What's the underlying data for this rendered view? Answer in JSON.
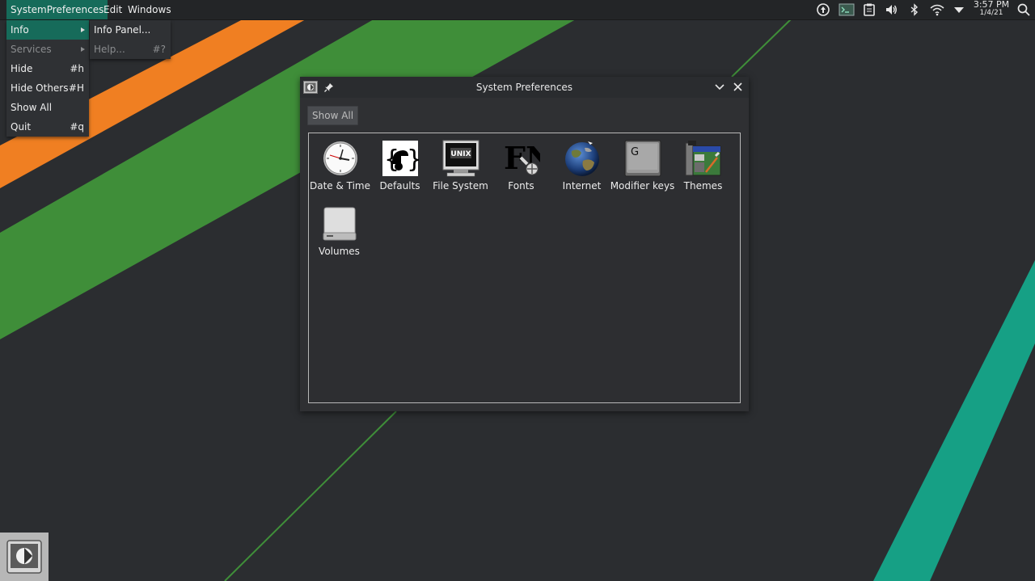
{
  "menubar": {
    "app_menu": "SystemPreferences",
    "edit": "Edit",
    "windows": "Windows"
  },
  "clock": {
    "time": "3:57 PM",
    "date": "1/4/21"
  },
  "tray_icons": [
    "upload-icon",
    "terminal-icon",
    "clipboard-icon",
    "volume-icon",
    "bluetooth-icon",
    "wifi-icon",
    "dropdown-arrow-icon",
    "search-icon"
  ],
  "app_menu_items": [
    {
      "label": "Info",
      "shortcut": "",
      "submenu": true,
      "state": "active"
    },
    {
      "label": "Services",
      "shortcut": "",
      "submenu": true,
      "state": "disabled"
    },
    {
      "label": "Hide",
      "shortcut": "#h",
      "submenu": false,
      "state": "normal"
    },
    {
      "label": "Hide Others",
      "shortcut": "#H",
      "submenu": false,
      "state": "normal"
    },
    {
      "label": "Show All",
      "shortcut": "",
      "submenu": false,
      "state": "normal"
    },
    {
      "label": "Quit",
      "shortcut": "#q",
      "submenu": false,
      "state": "normal"
    }
  ],
  "info_submenu_items": [
    {
      "label": "Info Panel...",
      "shortcut": "",
      "state": "normal"
    },
    {
      "label": "Help...",
      "shortcut": "#?",
      "state": "disabled"
    }
  ],
  "window": {
    "title": "System Preferences",
    "show_all_label": "Show All",
    "prefs": [
      {
        "label": "Date & Time",
        "icon": "clock-icon"
      },
      {
        "label": "Defaults",
        "icon": "defaults-icon"
      },
      {
        "label": "File System",
        "icon": "unix-monitor-icon"
      },
      {
        "label": "Fonts",
        "icon": "fonts-icon"
      },
      {
        "label": "Internet",
        "icon": "globe-icon"
      },
      {
        "label": "Modifier keys",
        "icon": "key-icon"
      },
      {
        "label": "Themes",
        "icon": "themes-icon"
      },
      {
        "label": "Volumes",
        "icon": "drive-icon"
      }
    ],
    "unix_badge": "UNIX",
    "key_letter": "G",
    "fonts_letters": "FN"
  },
  "colors": {
    "desktop": "#2b2d30",
    "orange": "#f07f22",
    "green": "#3f8e39",
    "teal": "#16a085",
    "highlight": "#166b5a"
  }
}
